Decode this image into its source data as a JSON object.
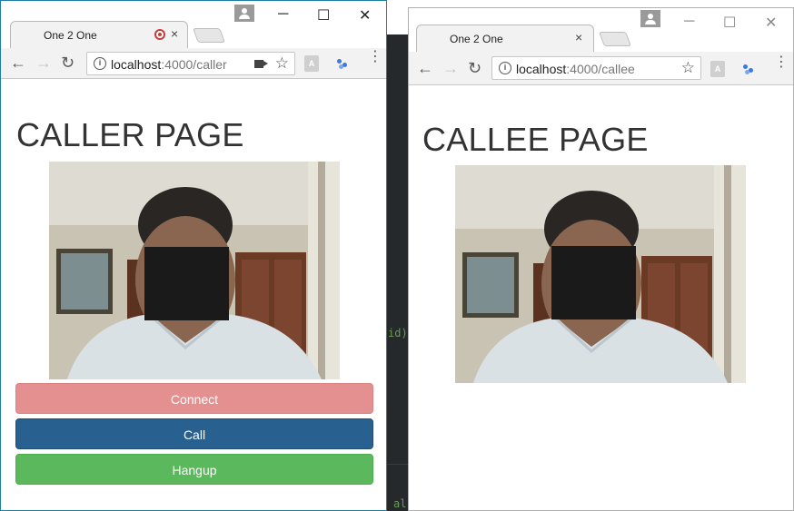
{
  "editor": {
    "snippets": [
      "id)",
      "al"
    ]
  },
  "caller_window": {
    "tab_title": "One 2 One",
    "tab_close": "×",
    "window_controls": {
      "minimize": "─",
      "maximize": "☐",
      "close": "✕"
    },
    "url_host": "localhost",
    "url_path": ":4000/caller",
    "page_title": "CALLER PAGE",
    "video_icon": "person-with-redaction-box",
    "buttons": {
      "connect": "Connect",
      "call": "Call",
      "hangup": "Hangup"
    },
    "colors": {
      "connect": "#e59090",
      "call": "#286090",
      "hangup": "#5cb85c"
    }
  },
  "callee_window": {
    "tab_title": "One 2 One",
    "tab_close": "×",
    "window_controls": {
      "minimize": "─",
      "maximize": "☐",
      "close": "✕"
    },
    "url_host": "localhost",
    "url_path": ":4000/callee",
    "page_title": "CALLEE PAGE",
    "video_icon": "person-with-redaction-box"
  },
  "icons": {
    "back": "←",
    "forward": "→",
    "reload": "↻",
    "star": "☆",
    "menu": "⋮",
    "info": "i"
  }
}
